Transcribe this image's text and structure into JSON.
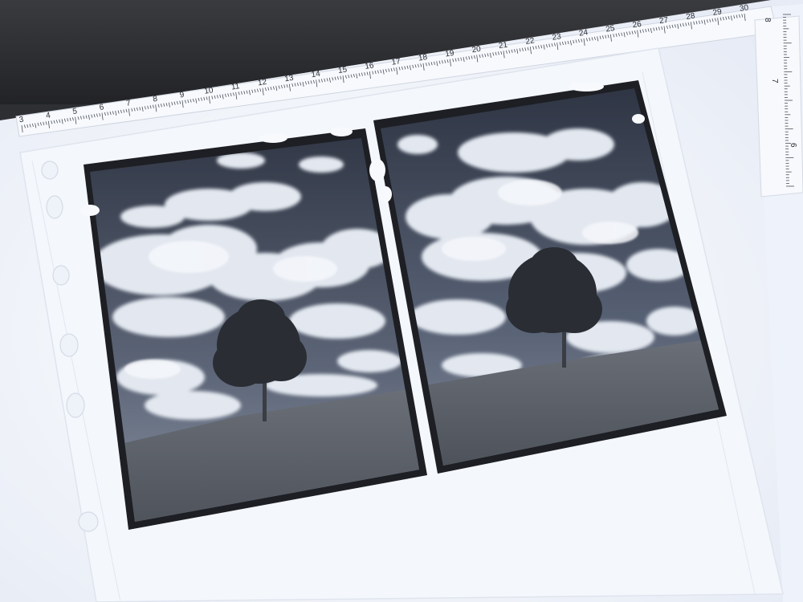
{
  "ruler": {
    "top_numbers": [
      "3",
      "4",
      "5",
      "6",
      "7",
      "8",
      "9",
      "10",
      "11",
      "12",
      "13",
      "14",
      "15",
      "16",
      "17",
      "18",
      "19",
      "20",
      "21",
      "22",
      "23",
      "24",
      "25",
      "26",
      "27",
      "28",
      "29",
      "30"
    ],
    "side_numbers": [
      "8",
      "7",
      "6"
    ]
  },
  "photo": {
    "subject": "black-and-white film negatives of a lone tree on a grassy hill",
    "frames": 2
  },
  "colors": {
    "lightbox": "#f1f4fb",
    "sleeve_edge": "#d9dee8",
    "sky_dark": "#3f4655",
    "cloud": "#e9edf4",
    "grass": "#5b6068",
    "film_border": "#1d1f24"
  }
}
